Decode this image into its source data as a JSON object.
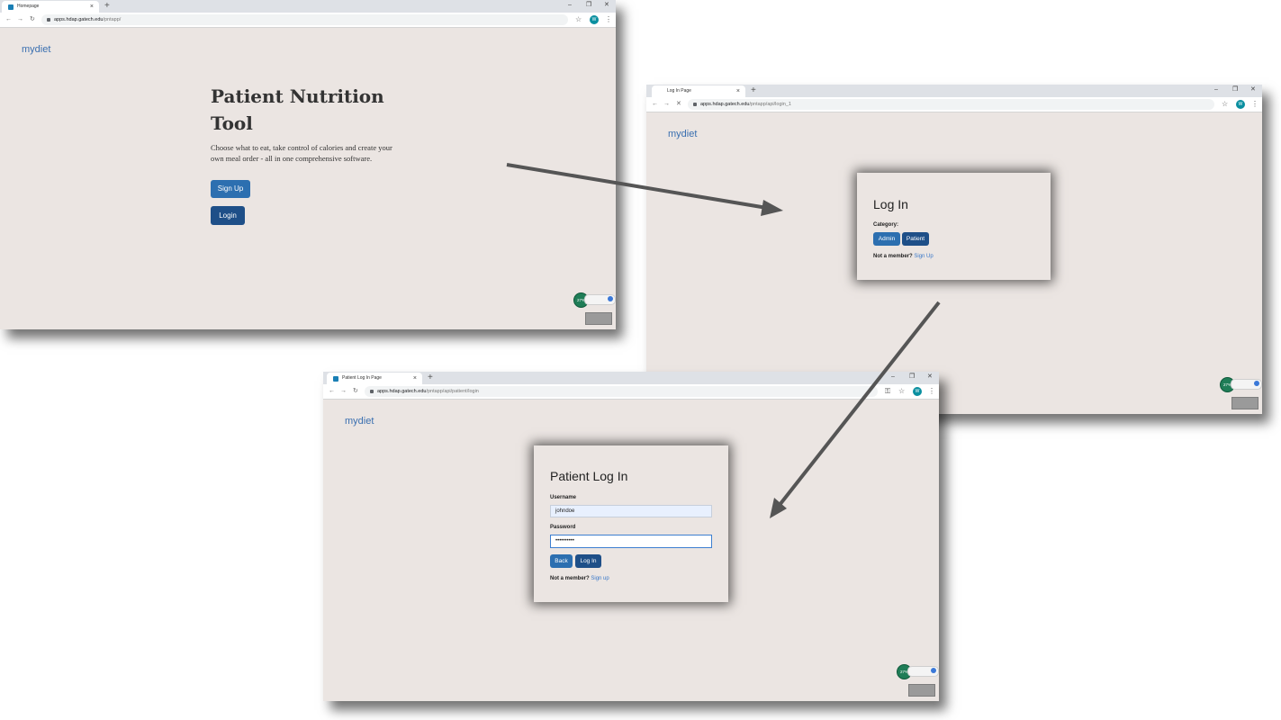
{
  "homepage_window": {
    "tab_title": "Homepage",
    "new_tab": "+",
    "window_controls": {
      "minimize": "–",
      "restore": "❐",
      "close": "✕"
    },
    "url_host": "apps.hdap.gatech.edu",
    "url_path": "/pntapp/",
    "avatar_letter": "W",
    "brand": "mydiet",
    "hero_title_line1": "Patient Nutrition",
    "hero_title_line2": "Tool",
    "hero_text_line1": "Choose what to eat, take control of calories and create your",
    "hero_text_line2": "own meal order - all in one comprehensive software.",
    "signup_button": "Sign Up",
    "login_button": "Login",
    "indicator_percent": "27%"
  },
  "login_window": {
    "tab_title": "Log In Page",
    "new_tab": "+",
    "window_controls": {
      "minimize": "–",
      "restore": "❐",
      "close": "✕"
    },
    "url_host": "apps.hdap.gatech.edu",
    "url_path": "/pntapp/api/login_1",
    "avatar_letter": "W",
    "brand": "mydiet",
    "card_title": "Log In",
    "category_label": "Category:",
    "admin_button": "Admin",
    "patient_button": "Patient",
    "not_member": "Not a member?",
    "signup_link": "Sign Up",
    "indicator_percent": "27%"
  },
  "patient_window": {
    "tab_title": "Patient Log In Page",
    "new_tab": "+",
    "window_controls": {
      "minimize": "–",
      "restore": "❐",
      "close": "✕"
    },
    "url_host": "apps.hdap.gatech.edu",
    "url_path": "/pntapp/api/patient/login",
    "avatar_letter": "W",
    "brand": "mydiet",
    "card_title": "Patient Log In",
    "username_label": "Username",
    "username_value": "johndoe",
    "password_label": "Password",
    "password_value": "••••••••••",
    "back_button": "Back",
    "login_button": "Log In",
    "not_member": "Not a member?",
    "signup_link": "Sign up",
    "indicator_percent": "27%"
  },
  "colors": {
    "page_bg": "#ebe5e2",
    "brand": "#3a6fb0",
    "button": "#2c6fb0",
    "button_active": "#1e4f88",
    "arrow": "#555555"
  }
}
